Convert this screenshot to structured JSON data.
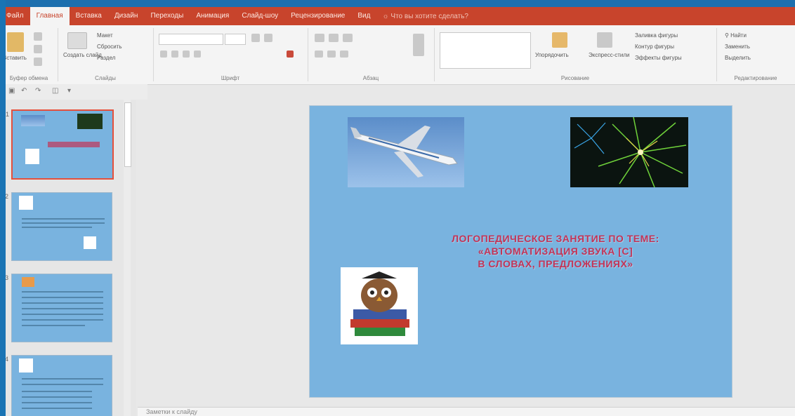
{
  "tabs": [
    {
      "label": "Файл",
      "active": false
    },
    {
      "label": "Главная",
      "active": true
    },
    {
      "label": "Вставка",
      "active": false
    },
    {
      "label": "Дизайн",
      "active": false
    },
    {
      "label": "Переходы",
      "active": false
    },
    {
      "label": "Анимация",
      "active": false
    },
    {
      "label": "Слайд-шоу",
      "active": false
    },
    {
      "label": "Рецензирование",
      "active": false
    },
    {
      "label": "Вид",
      "active": false
    }
  ],
  "tell_me": "Что вы хотите сделать?",
  "ribbon": {
    "clipboard": {
      "paste": "Вставить",
      "group": "Буфер обмена"
    },
    "slides": {
      "new_slide": "Создать слайд",
      "layout": "Макет",
      "reset": "Сбросить",
      "section": "Раздел",
      "group": "Слайды"
    },
    "font": {
      "group": "Шрифт"
    },
    "paragraph": {
      "group": "Абзац"
    },
    "drawing": {
      "arrange": "Упорядочить",
      "quick_styles": "Экспресс-стили",
      "fill": "Заливка фигуры",
      "outline": "Контур фигуры",
      "effects": "Эффекты фигуры",
      "group": "Рисование"
    },
    "editing": {
      "find": "Найти",
      "replace": "Заменить",
      "select": "Выделить",
      "group": "Редактирование"
    }
  },
  "slide_numbers": [
    "1",
    "2",
    "3",
    "4"
  ],
  "slide": {
    "title_lines": [
      "ЛОГОПЕДИЧЕСКОЕ ЗАНЯТИЕ ПО ТЕМЕ:",
      "«АВТОМАТИЗАЦИЯ ЗВУКА [С]",
      "В СЛОВАХ, ПРЕДЛОЖЕНИЯХ»"
    ]
  },
  "notes_placeholder": "Заметки к слайду",
  "colors": {
    "accent": "#c8442c",
    "slide_bg": "#79b3df",
    "title": "#c23457"
  }
}
